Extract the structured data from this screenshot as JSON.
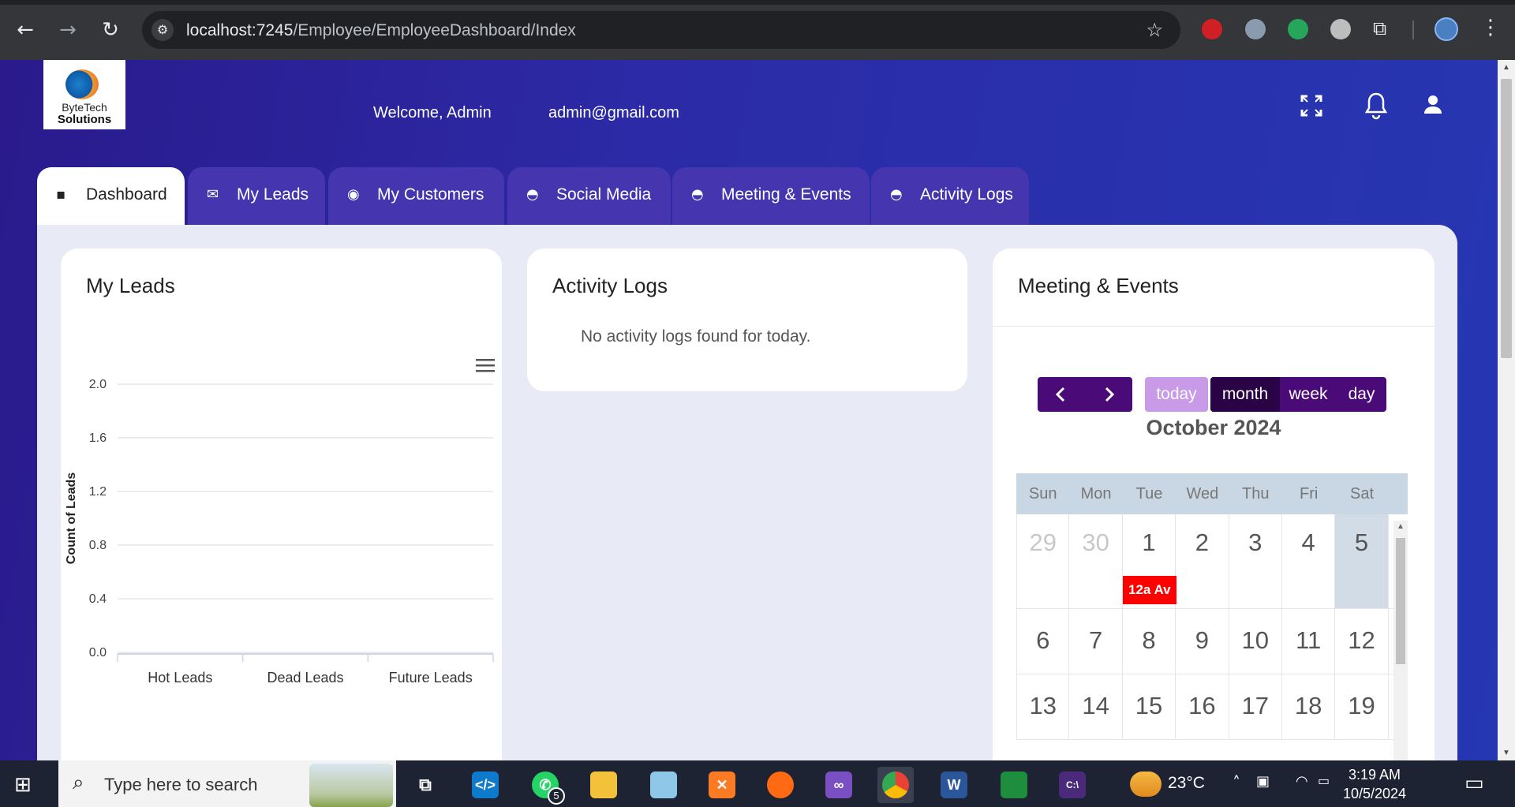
{
  "browser": {
    "url_host": "localhost:7245",
    "url_path": "/Employee/EmployeeDashboard/Index"
  },
  "header": {
    "logo_line1": "ByteTech",
    "logo_line2": "Solutions",
    "welcome": "Welcome, Admin",
    "email": "admin@gmail.com"
  },
  "tabs": [
    {
      "label": "Dashboard",
      "icon": "grid-icon"
    },
    {
      "label": "My Leads",
      "icon": "inbox-icon"
    },
    {
      "label": "My Customers",
      "icon": "customers-icon"
    },
    {
      "label": "Social Media",
      "icon": "basket-icon"
    },
    {
      "label": "Meeting & Events",
      "icon": "basket-icon"
    },
    {
      "label": "Activity Logs",
      "icon": "basket-icon"
    }
  ],
  "leads_card": {
    "title": "My Leads"
  },
  "activity_card": {
    "title": "Activity Logs",
    "empty_text": "No activity logs found for today."
  },
  "calendar_card": {
    "title": "Meeting & Events",
    "today_label": "today",
    "month_label": "month",
    "week_label": "week",
    "day_label": "day",
    "month_title": "October 2024",
    "weekdays": [
      "Sun",
      "Mon",
      "Tue",
      "Wed",
      "Thu",
      "Fri",
      "Sat"
    ],
    "weeks": [
      [
        "29",
        "30",
        "1",
        "2",
        "3",
        "4",
        "5"
      ],
      [
        "6",
        "7",
        "8",
        "9",
        "10",
        "11",
        "12"
      ],
      [
        "13",
        "14",
        "15",
        "16",
        "17",
        "18",
        "19"
      ]
    ],
    "event_label": "12a Av"
  },
  "chart_data": {
    "type": "bar",
    "categories": [
      "Hot Leads",
      "Dead Leads",
      "Future Leads"
    ],
    "values": [
      0,
      0,
      0
    ],
    "ylabel": "Count of Leads",
    "xlabel": "",
    "yticks": [
      "0.0",
      "0.4",
      "0.8",
      "1.2",
      "1.6",
      "2.0"
    ],
    "ylim": [
      0,
      2
    ],
    "grid": true
  },
  "taskbar": {
    "search_placeholder": "Type here to search",
    "whatsapp_badge": "5",
    "temperature": "23°C",
    "time": "3:19 AM",
    "date": "10/5/2024"
  },
  "colors": {
    "accent_purple": "#4a0a77",
    "today_purple": "#c89ae8",
    "event_red": "#ff0000",
    "tab_bg": "#4536b0"
  }
}
